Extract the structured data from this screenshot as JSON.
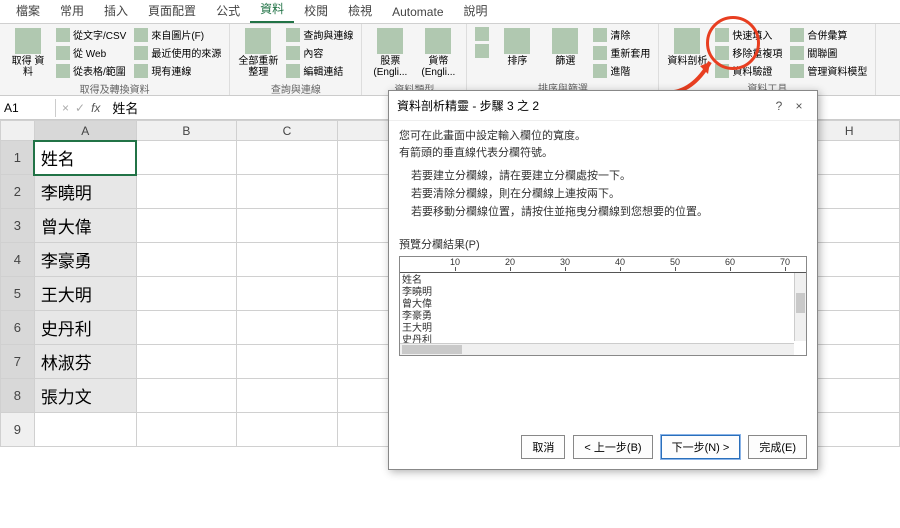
{
  "tabs": [
    "檔案",
    "常用",
    "插入",
    "頁面配置",
    "公式",
    "資料",
    "校閱",
    "檢視",
    "Automate",
    "說明"
  ],
  "active_tab_index": 5,
  "ribbon": {
    "group1": {
      "main": "取得\n資料",
      "items": [
        "從文字/CSV",
        "從 Web",
        "從表格/範圍"
      ],
      "items2": [
        "來自圖片(F)",
        "最近使用的來源",
        "現有連線"
      ],
      "label": "取得及轉換資料"
    },
    "group2": {
      "main": "全部重新整理",
      "items": [
        "查詢與連線",
        "內容",
        "編輯連結"
      ],
      "label": "查詢與連線"
    },
    "group3": {
      "stocks": "股票 (Engli...",
      "curr": "貨幣 (Engli...",
      "label": "資料類型"
    },
    "group4": {
      "sort": "排序",
      "filter": "篩選",
      "items": [
        "清除",
        "重新套用",
        "進階"
      ],
      "label": "排序與篩選"
    },
    "group5": {
      "split": "資料剖析",
      "items": [
        "快速填入",
        "移除重複項",
        "資料驗證"
      ],
      "items2": [
        "合併彙算",
        "關聯圖",
        "管理資料模型"
      ],
      "label": "資料工具"
    }
  },
  "namebox": "A1",
  "formula": "姓名",
  "columns": [
    "A",
    "B",
    "C",
    "H"
  ],
  "rows": [
    {
      "n": "1",
      "a": "姓名"
    },
    {
      "n": "2",
      "a": "李曉明"
    },
    {
      "n": "3",
      "a": "曾大偉"
    },
    {
      "n": "4",
      "a": "李豪勇"
    },
    {
      "n": "5",
      "a": "王大明"
    },
    {
      "n": "6",
      "a": "史丹利"
    },
    {
      "n": "7",
      "a": "林淑芬"
    },
    {
      "n": "8",
      "a": "張力文"
    },
    {
      "n": "9",
      "a": ""
    }
  ],
  "wizard": {
    "title": "資料剖析精靈 - 步驟 3 之 2",
    "help": "?",
    "close": "×",
    "intro1": "您可在此畫面中設定輸入欄位的寬度。",
    "intro2": "有箭頭的垂直線代表分欄符號。",
    "hint1": "若要建立分欄線，請在要建立分欄處按一下。",
    "hint2": "若要清除分欄線，則在分欄線上連按兩下。",
    "hint3": "若要移動分欄線位置，請按住並拖曳分欄線到您想要的位置。",
    "preview_label": "預覽分欄結果(P)",
    "ticks": [
      "10",
      "20",
      "30",
      "40",
      "50",
      "60",
      "70"
    ],
    "preview_rows": [
      "姓名",
      "李曉明",
      "曾大偉",
      "李豪勇",
      "王大明",
      "史丹利"
    ],
    "buttons": {
      "cancel": "取消",
      "back": "< 上一步(B)",
      "next": "下一步(N) >",
      "finish": "完成(E)"
    }
  }
}
